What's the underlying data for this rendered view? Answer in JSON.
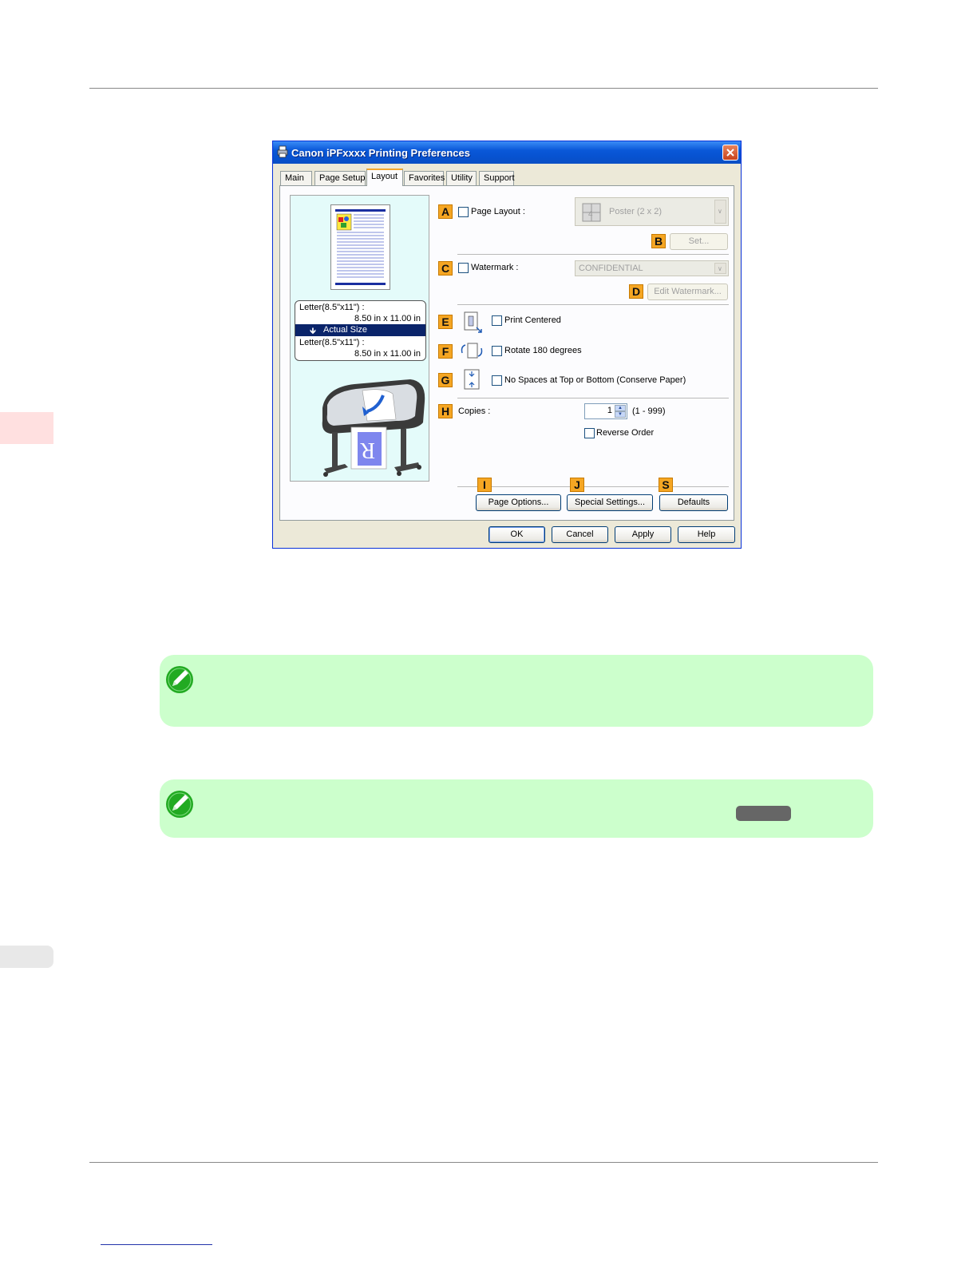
{
  "dialog": {
    "title": "Canon iPFxxxx Printing Preferences",
    "tabs": [
      "Main",
      "Page Setup",
      "Layout",
      "Favorites",
      "Utility",
      "Support"
    ],
    "active_tab": "Layout",
    "preview": {
      "paper_size_line1": "Letter(8.5\"x11\") :",
      "paper_size_line1_dims": "8.50 in x 11.00 in",
      "mode": "Actual Size",
      "output_size_line1": "Letter(8.5\"x11\") :",
      "output_size_line1_dims": "8.50 in x 11.00 in"
    },
    "markers": {
      "a": "A",
      "b": "B",
      "c": "C",
      "d": "D",
      "e": "E",
      "f": "F",
      "g": "G",
      "h": "H",
      "i": "I",
      "j": "J",
      "s": "S"
    },
    "page_layout": {
      "label": "Page Layout :",
      "checked": false,
      "value": "Poster (2 x 2)",
      "set_button": "Set..."
    },
    "watermark": {
      "label": "Watermark :",
      "checked": false,
      "value": "CONFIDENTIAL",
      "edit_button": "Edit Watermark..."
    },
    "print_centered": {
      "label": "Print Centered",
      "checked": false
    },
    "rotate": {
      "label": "Rotate 180 degrees",
      "checked": false
    },
    "no_spaces": {
      "label": "No Spaces at Top or Bottom (Conserve Paper)",
      "checked": false
    },
    "copies": {
      "label": "Copies :",
      "value": "1",
      "range": "(1 - 999)"
    },
    "reverse_order": {
      "label": "Reverse Order",
      "checked": false
    },
    "buttons": {
      "page_options": "Page Options...",
      "special_settings": "Special Settings...",
      "defaults": "Defaults",
      "ok": "OK",
      "cancel": "Cancel",
      "apply": "Apply",
      "help": "Help"
    }
  },
  "colors": {
    "accent_marker": "#f5a623",
    "note_bg": "#ccffcc",
    "side_tab_top": "#ffe0e0",
    "side_tab_bottom": "#e8e8e8",
    "title_blue": "#0a58d8"
  },
  "icons": [
    "printer-icon",
    "close-icon",
    "poster-layout-icon",
    "print-centered-icon",
    "rotate-icon",
    "no-spaces-icon",
    "note-pencil-icon"
  ]
}
